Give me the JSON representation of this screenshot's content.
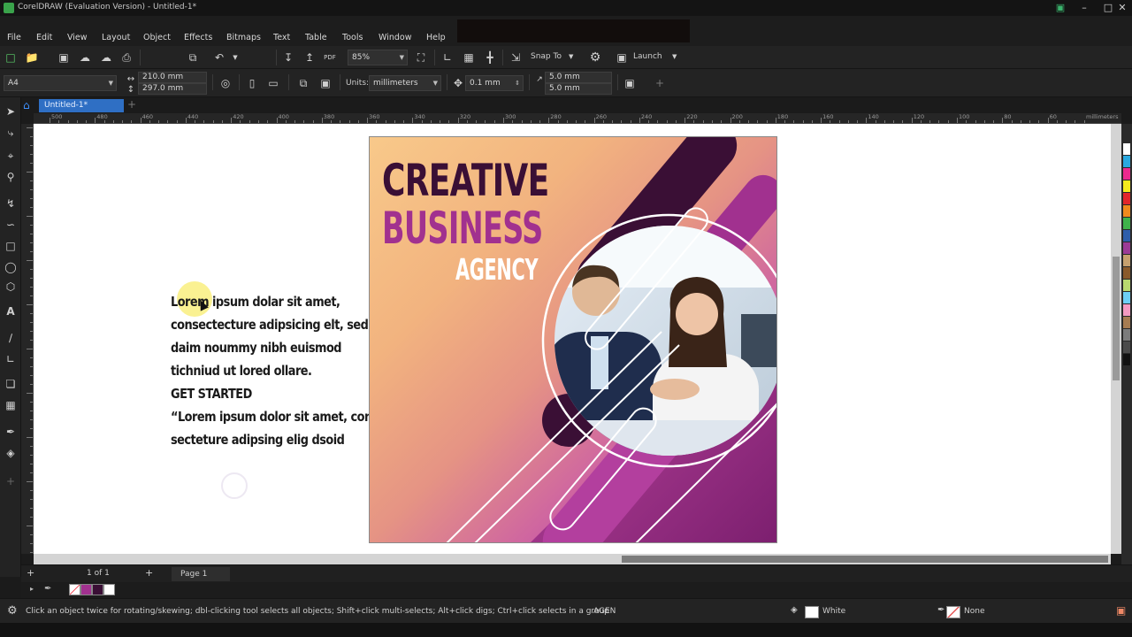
{
  "app": {
    "title": "CorelDRAW (Evaluation Version) - Untitled-1*",
    "window_controls": [
      "–",
      "□",
      "✕"
    ]
  },
  "menu": [
    "File",
    "Edit",
    "View",
    "Layout",
    "Object",
    "Effects",
    "Bitmaps",
    "Text",
    "Table",
    "Tools",
    "Window",
    "Help"
  ],
  "toolbar": {
    "zoom_value": "85%",
    "snap_to_label": "Snap To",
    "launch_label": "Launch"
  },
  "property_bar": {
    "page_size": "A4",
    "width": "210.0 mm",
    "height": "297.0 mm",
    "units_label": "Units:",
    "units_value": "millimeters",
    "nudge_value": "0.1 mm",
    "dup_x": "5.0 mm",
    "dup_y": "5.0 mm"
  },
  "document_tab": "Untitled-1*",
  "ruler": {
    "h_labels": [
      "500",
      "480",
      "460",
      "440",
      "420",
      "400",
      "380",
      "360",
      "340",
      "320",
      "300",
      "280",
      "260",
      "240",
      "220",
      "200",
      "180",
      "160",
      "140",
      "120",
      "100",
      "80",
      "60"
    ],
    "unit": "millimeters"
  },
  "canvas": {
    "body_lines": [
      "Lorem ipsum dolar sit amet,",
      "consectecture adipsicing elt, sed",
      "daim noummy nibh euismod",
      "tichniud ut lored ollare.",
      " GET STARTED",
      "“Lorem ipsum dolor sit amet, con-",
      "secteture adipsing elig dsoid"
    ],
    "poster": {
      "line1": "CREATIVE",
      "line2": "BUSINESS",
      "line3": "AGENCY",
      "photo_icon": "business-partners-photo"
    }
  },
  "page_nav": {
    "counter": "1 of 1",
    "page_tab": "Page 1"
  },
  "status": {
    "hint": "Click an object twice for rotating/skewing; dbl-clicking tool selects all objects; Shift+click multi-selects; Alt+click digs; Ctrl+click selects in a group",
    "object_name": "AGEN",
    "fill_label": "White",
    "outline_label": "None"
  },
  "colors": {
    "accent": "#2f6fc4",
    "poster_dark": "#3a0f35",
    "poster_magenta": "#a1318f",
    "gradient_start": "#f8c98a",
    "gradient_end": "#a43d97"
  }
}
